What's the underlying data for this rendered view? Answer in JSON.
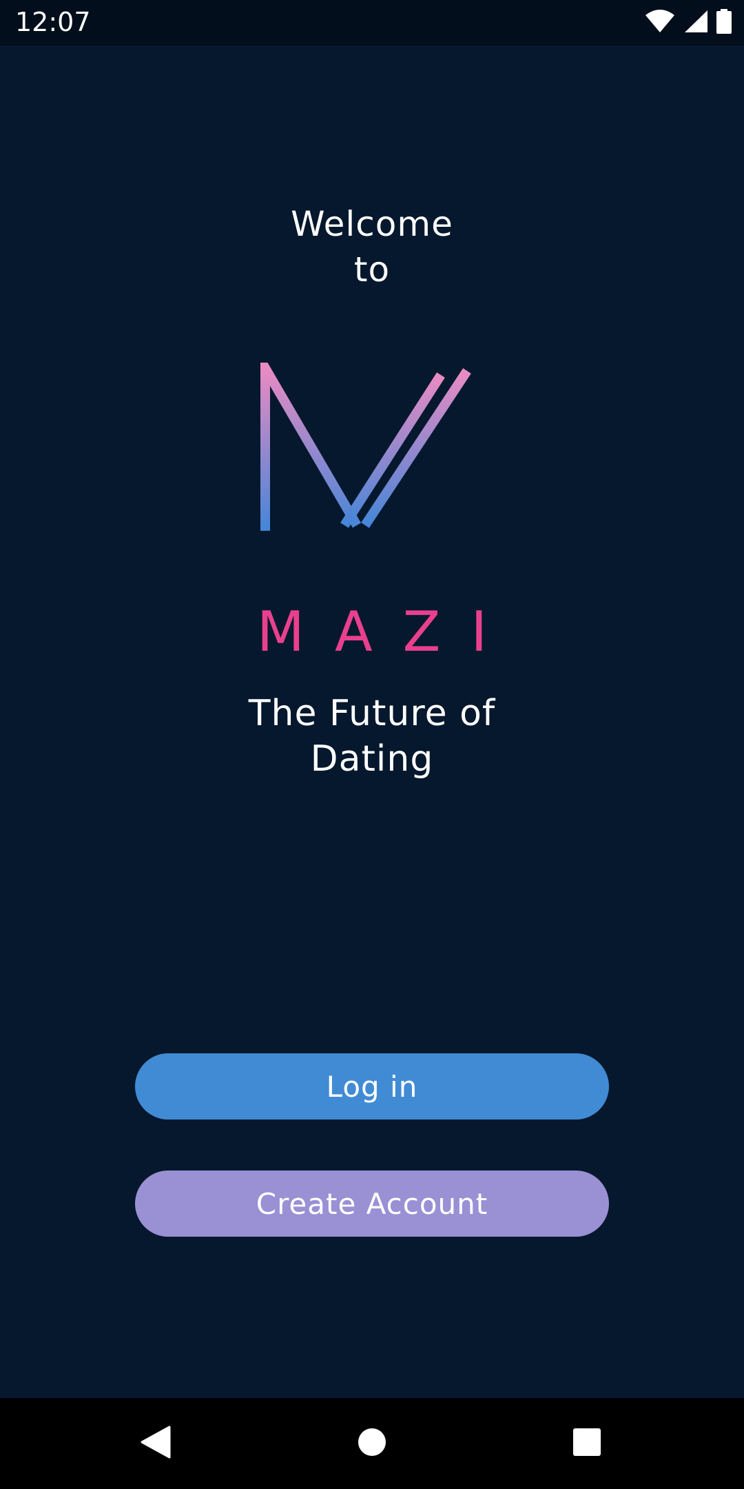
{
  "status_bar": {
    "time": "12:07",
    "icons": [
      "wifi-icon",
      "cell-signal-icon",
      "battery-icon"
    ]
  },
  "welcome": {
    "line1": "Welcome",
    "line2": "to"
  },
  "logo": {
    "icon": "mazi-logo",
    "gradient_top": "#e98bc3",
    "gradient_bottom": "#4486d8"
  },
  "brand": {
    "name": "MAZI"
  },
  "tagline": {
    "line1": "The Future of",
    "line2": "Dating"
  },
  "buttons": {
    "login_label": "Log in",
    "create_account_label": "Create Account"
  },
  "nav_bar": {
    "icons": [
      "back-icon",
      "home-icon",
      "recents-icon"
    ]
  },
  "colors": {
    "background": "#06182d",
    "brand": "#e8408f",
    "login_button": "#418bd5",
    "create_button": "#9a90d4"
  }
}
